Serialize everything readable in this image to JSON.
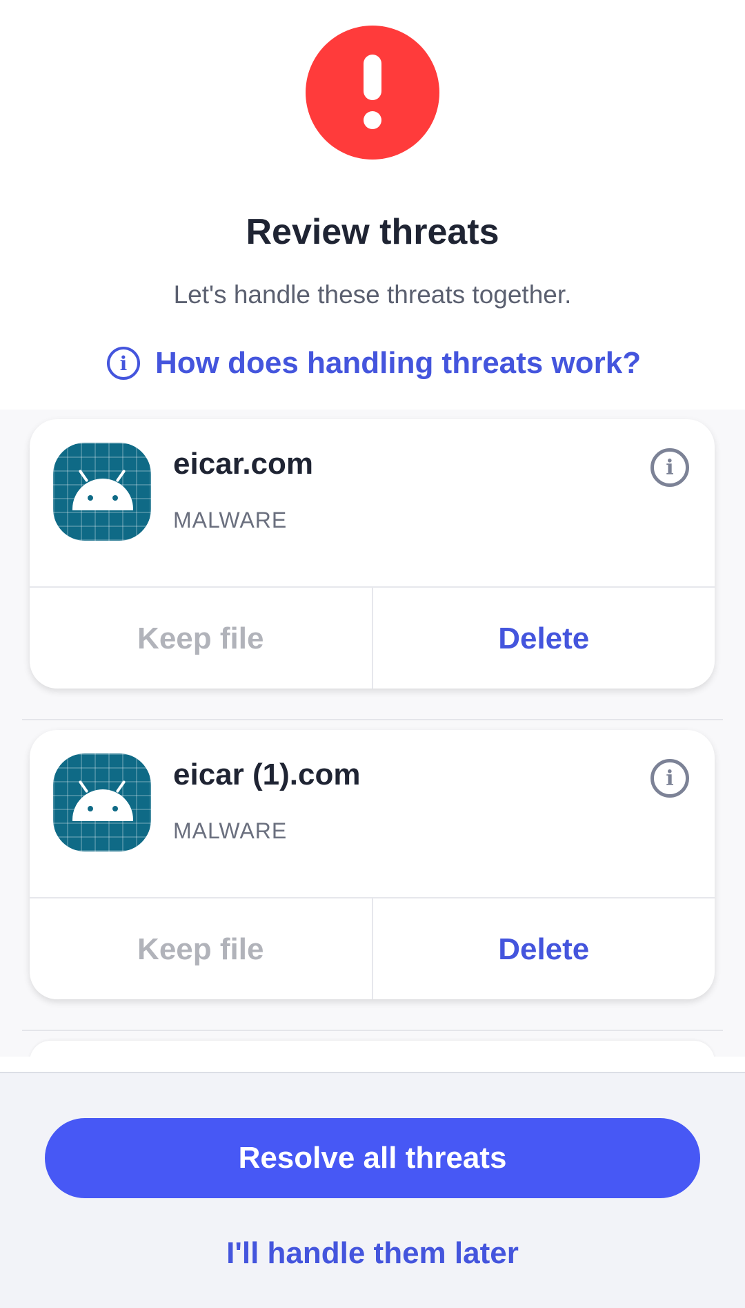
{
  "header": {
    "title": "Review threats",
    "subtitle": "Let's handle these threats together.",
    "help_link": "How does handling threats work?"
  },
  "threats": [
    {
      "name": "eicar.com",
      "type": "MALWARE",
      "keep_label": "Keep file",
      "delete_label": "Delete"
    },
    {
      "name": "eicar (1).com",
      "type": "MALWARE",
      "keep_label": "Keep file",
      "delete_label": "Delete"
    }
  ],
  "footer": {
    "resolve_label": "Resolve all threats",
    "later_label": "I'll handle them later"
  },
  "icons": {
    "alert": "exclamation-circle-icon",
    "info": "info-circle-icon",
    "app": "android-app-icon"
  },
  "colors": {
    "alert_red": "#ff3b3b",
    "accent_blue": "#4455dd",
    "button_blue": "#4758f5"
  }
}
